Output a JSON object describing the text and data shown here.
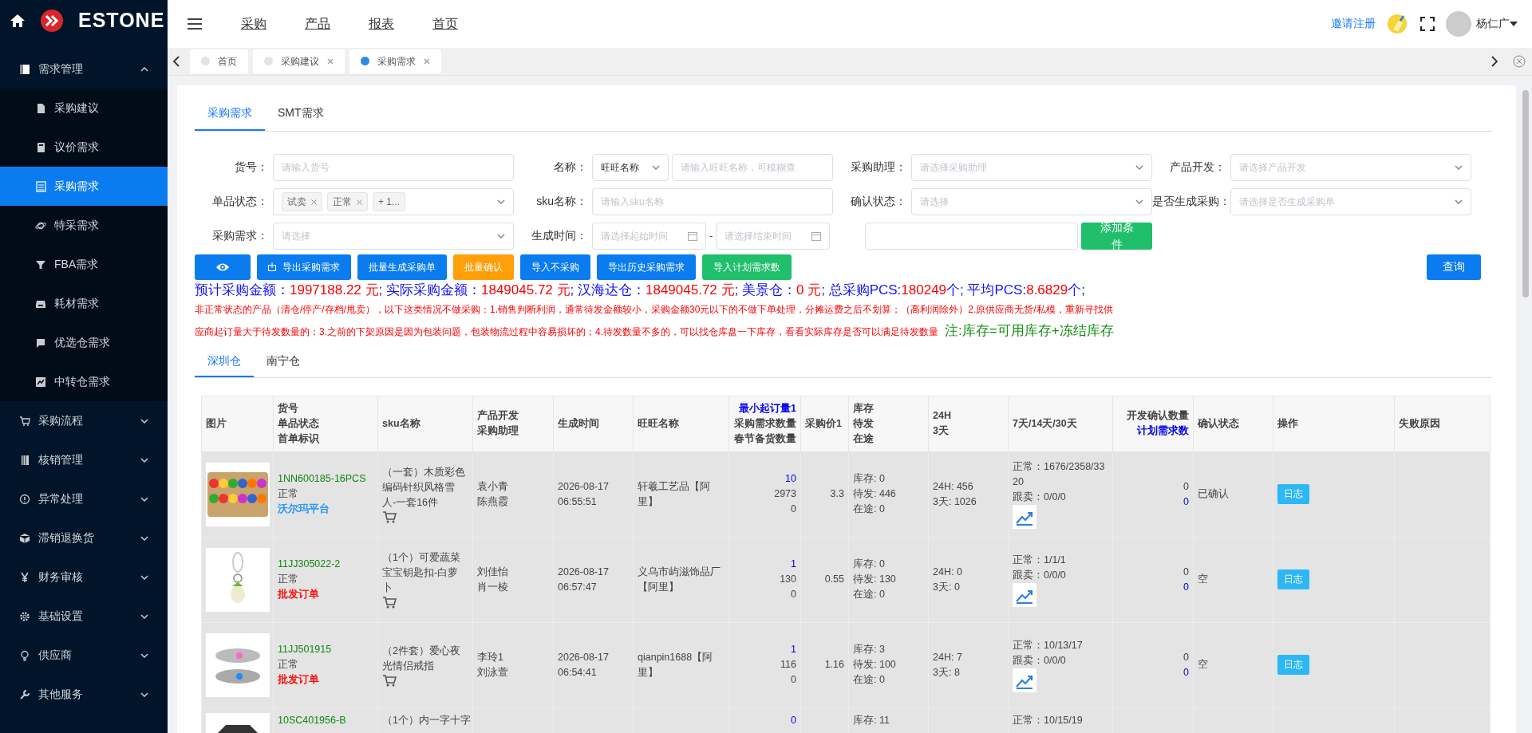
{
  "sidebar": {
    "logo": "ESTONE",
    "items": [
      {
        "label": "需求管理",
        "expanded": true,
        "children": [
          {
            "label": "采购建议",
            "selected": false
          },
          {
            "label": "议价需求",
            "selected": false
          },
          {
            "label": "采购需求",
            "selected": true
          },
          {
            "label": "特采需求",
            "selected": false
          },
          {
            "label": "FBA需求",
            "selected": false
          },
          {
            "label": "耗材需求",
            "selected": false
          },
          {
            "label": "优选仓需求",
            "selected": false
          },
          {
            "label": "中转仓需求",
            "selected": false
          }
        ]
      },
      {
        "label": "采购流程",
        "expanded": false
      },
      {
        "label": "核销管理",
        "expanded": false
      },
      {
        "label": "异常处理",
        "expanded": false
      },
      {
        "label": "滞销退换货",
        "expanded": false
      },
      {
        "label": "财务审核",
        "expanded": false
      },
      {
        "label": "基础设置",
        "expanded": false
      },
      {
        "label": "供应商",
        "expanded": false
      },
      {
        "label": "其他服务",
        "expanded": false
      }
    ]
  },
  "topbar": {
    "nav": [
      "采购",
      "产品",
      "报表",
      "首页"
    ],
    "invite_link": "邀请注册",
    "user": "杨仁广"
  },
  "page_tabs": [
    {
      "label": "首页",
      "selected": false,
      "closable": false
    },
    {
      "label": "采购建议",
      "selected": false,
      "closable": true
    },
    {
      "label": "采购需求",
      "selected": true,
      "closable": true
    }
  ],
  "content_tabs": [
    {
      "label": "采购需求",
      "selected": true
    },
    {
      "label": "SMT需求",
      "selected": false
    }
  ],
  "filters": [
    {
      "kind": "text",
      "label": "货号：",
      "placeholder": "请输入货号"
    },
    {
      "kind": "combo",
      "label": "名称：",
      "value": "旺旺名称",
      "placeholder": "请输入旺旺名称，可模糊查"
    },
    {
      "kind": "select",
      "label": "采购助理：",
      "placeholder": "请选择采购助理"
    },
    {
      "kind": "select",
      "label": "产品开发：",
      "placeholder": "请选择产品开发"
    },
    {
      "kind": "tags",
      "label": "单品状态：",
      "tags": [
        "试卖",
        "正常"
      ],
      "more": "+ 1..."
    },
    {
      "kind": "text",
      "label": "sku名称：",
      "placeholder": "请输入sku名称"
    },
    {
      "kind": "select",
      "label": "确认状态：",
      "placeholder": "请选择"
    },
    {
      "kind": "select",
      "label": "是否生成采购：",
      "placeholder": "请选择是否生成采购单"
    },
    {
      "kind": "select",
      "label": "采购需求：",
      "placeholder": "请选择"
    },
    {
      "kind": "daterange",
      "label": "生成时间：",
      "placeholder": "请选择起始时间",
      "placeholder_end": "请选择结束时间",
      "separator": "-"
    },
    {
      "kind": "plain",
      "button": "添加条件"
    }
  ],
  "actions": [
    {
      "kind": "eye"
    },
    {
      "kind": "primary",
      "label": "导出采购需求",
      "icon": true
    },
    {
      "kind": "primary",
      "label": "批量生成采购单"
    },
    {
      "kind": "warning",
      "label": "批量确认"
    },
    {
      "kind": "primary",
      "label": "导入不采购"
    },
    {
      "kind": "primary",
      "label": "导出历史采购需求"
    },
    {
      "kind": "success",
      "label": "导入计划需求数"
    }
  ],
  "query_button": "查询",
  "summary": [
    {
      "kind": "label",
      "text": "预计采购金额："
    },
    {
      "kind": "value",
      "text": "1997188.22 元"
    },
    {
      "kind": "label",
      "text": "; 实际采购金额："
    },
    {
      "kind": "value",
      "text": "1849045.72 元"
    },
    {
      "kind": "label",
      "text": "; 汉海达仓："
    },
    {
      "kind": "value",
      "text": "1849045.72 元"
    },
    {
      "kind": "label",
      "text": "; 美景仓："
    },
    {
      "kind": "value",
      "text": "0 元"
    },
    {
      "kind": "label",
      "text": "; 总采购PCS:"
    },
    {
      "kind": "value",
      "text": "180249"
    },
    {
      "kind": "label",
      "text": "个; 平均PCS:"
    },
    {
      "kind": "value",
      "text": "8.6829"
    },
    {
      "kind": "label",
      "text": "个;"
    }
  ],
  "notice_lines": [
    "非正常状态的产品（清仓/停产/存档/甩卖），以下这类情况不做采购：1.销售判断利润，通常待发金额较小，采购金额30元以下的不做下单处理，分摊运费之后不划算；（高利润除外）2.原供应商无货/私模，重新寻找供",
    "应商起订量大于待发数量的；3.之前的下架原因是因为包装问题，包装物流过程中容易损坏的；4.待发数量不多的，可以找仓库盘一下库存，看看实际库存是否可以满足待发数量"
  ],
  "notice_note": "注:库存=可用库存+冻结库存",
  "warehouse_tabs": [
    {
      "label": "深圳仓",
      "selected": true
    },
    {
      "label": "南宁仓",
      "selected": false
    }
  ],
  "table": {
    "columns": [
      {
        "lines": [
          {
            "text": "图片"
          }
        ]
      },
      {
        "lines": [
          {
            "text": "货号"
          },
          {
            "text": "单品状态"
          },
          {
            "text": "首单标识"
          }
        ]
      },
      {
        "lines": [
          {
            "text": "sku名称"
          }
        ]
      },
      {
        "lines": [
          {
            "text": "产品开发"
          },
          {
            "text": "采购助理"
          }
        ]
      },
      {
        "lines": [
          {
            "text": "生成时间"
          }
        ]
      },
      {
        "lines": [
          {
            "text": "旺旺名称"
          }
        ]
      },
      {
        "lines": [
          {
            "text": "最小起订量1",
            "highlight": true
          },
          {
            "text": "采购需求数量"
          },
          {
            "text": "春节备货数量"
          }
        ]
      },
      {
        "lines": [
          {
            "text": "采购价1"
          }
        ]
      },
      {
        "lines": [
          {
            "text": "库存"
          },
          {
            "text": "待发"
          },
          {
            "text": "在途"
          }
        ]
      },
      {
        "lines": [
          {
            "text": "24H"
          },
          {
            "text": "3天"
          }
        ]
      },
      {
        "lines": [
          {
            "text": "7天/14天/30天"
          }
        ]
      },
      {
        "lines": [
          {
            "text": "开发确认数量"
          },
          {
            "text": "计划需求数",
            "highlight": true
          }
        ]
      },
      {
        "lines": [
          {
            "text": "确认状态"
          }
        ]
      },
      {
        "lines": [
          {
            "text": "操作"
          }
        ]
      },
      {
        "lines": [
          {
            "text": "失败原因"
          }
        ]
      }
    ],
    "rows": [
      {
        "code": "1NN600185-16PCS",
        "status": "正常",
        "tag": {
          "label": "沃尔玛平台",
          "color": "#1890ff"
        },
        "sku_name": "（一套）木质彩色编码针织风格雪人-一套16件",
        "developer": "袁小青",
        "assistant": "陈燕霞",
        "date": "2026-08-17",
        "time": "06:55:51",
        "wangwang": "轩羲工艺品【阿里】",
        "min_order": "10",
        "demand": "2973",
        "spring": "0",
        "price": "3.3",
        "stock": [
          "库存: 0",
          "待发: 446",
          "在途: 0"
        ],
        "sales": [
          "24H: 456",
          "3天: 1026"
        ],
        "periods": [
          "正常：1676/2358/3320",
          "跟卖：0/0/0"
        ],
        "dev_confirm": "0",
        "planned": "0",
        "confirm": "已确认",
        "action": "日志"
      },
      {
        "code": "11JJ305022-2",
        "status": "正常",
        "tag": {
          "label": "批发订单",
          "color": "#ff0000"
        },
        "sku_name": "（1个）可爱蔬菜宝宝钥匙扣-白萝卜",
        "developer": "刘佳怡",
        "assistant": "肖一棱",
        "date": "2026-08-17",
        "time": "06:57:47",
        "wangwang": "义乌市屿滋饰品厂【阿里】",
        "min_order": "1",
        "demand": "130",
        "spring": "0",
        "price": "0.55",
        "stock": [
          "库存: 0",
          "待发: 130",
          "在途: 0"
        ],
        "sales": [
          "24H: 0",
          "3天: 0"
        ],
        "periods": [
          "正常：1/1/1",
          "跟卖：0/0/0"
        ],
        "dev_confirm": "0",
        "planned": "0",
        "confirm": "空",
        "action": "日志"
      },
      {
        "code": "11JJ501915",
        "status": "正常",
        "tag": {
          "label": "批发订单",
          "color": "#ff0000"
        },
        "sku_name": "（2件套）爱心夜光情侣戒指",
        "developer": "李玲1",
        "assistant": "刘泳萱",
        "date": "2026-08-17",
        "time": "06:54:41",
        "wangwang": "qianpin1688【阿里】",
        "min_order": "1",
        "demand": "116",
        "spring": "0",
        "price": "1.16",
        "stock": [
          "库存: 3",
          "待发: 100",
          "在途: 0"
        ],
        "sales": [
          "24H: 7",
          "3天: 8"
        ],
        "periods": [
          "正常：10/13/17",
          "跟卖：0/0/0"
        ],
        "dev_confirm": "0",
        "planned": "0",
        "confirm": "空",
        "action": "日志"
      },
      {
        "code": "10SC401956-B",
        "sku_name": "（1个）内一字十字",
        "min_order": "0",
        "stock": [
          "库存: 11"
        ],
        "periods": [
          "正常：10/15/19"
        ]
      }
    ]
  }
}
